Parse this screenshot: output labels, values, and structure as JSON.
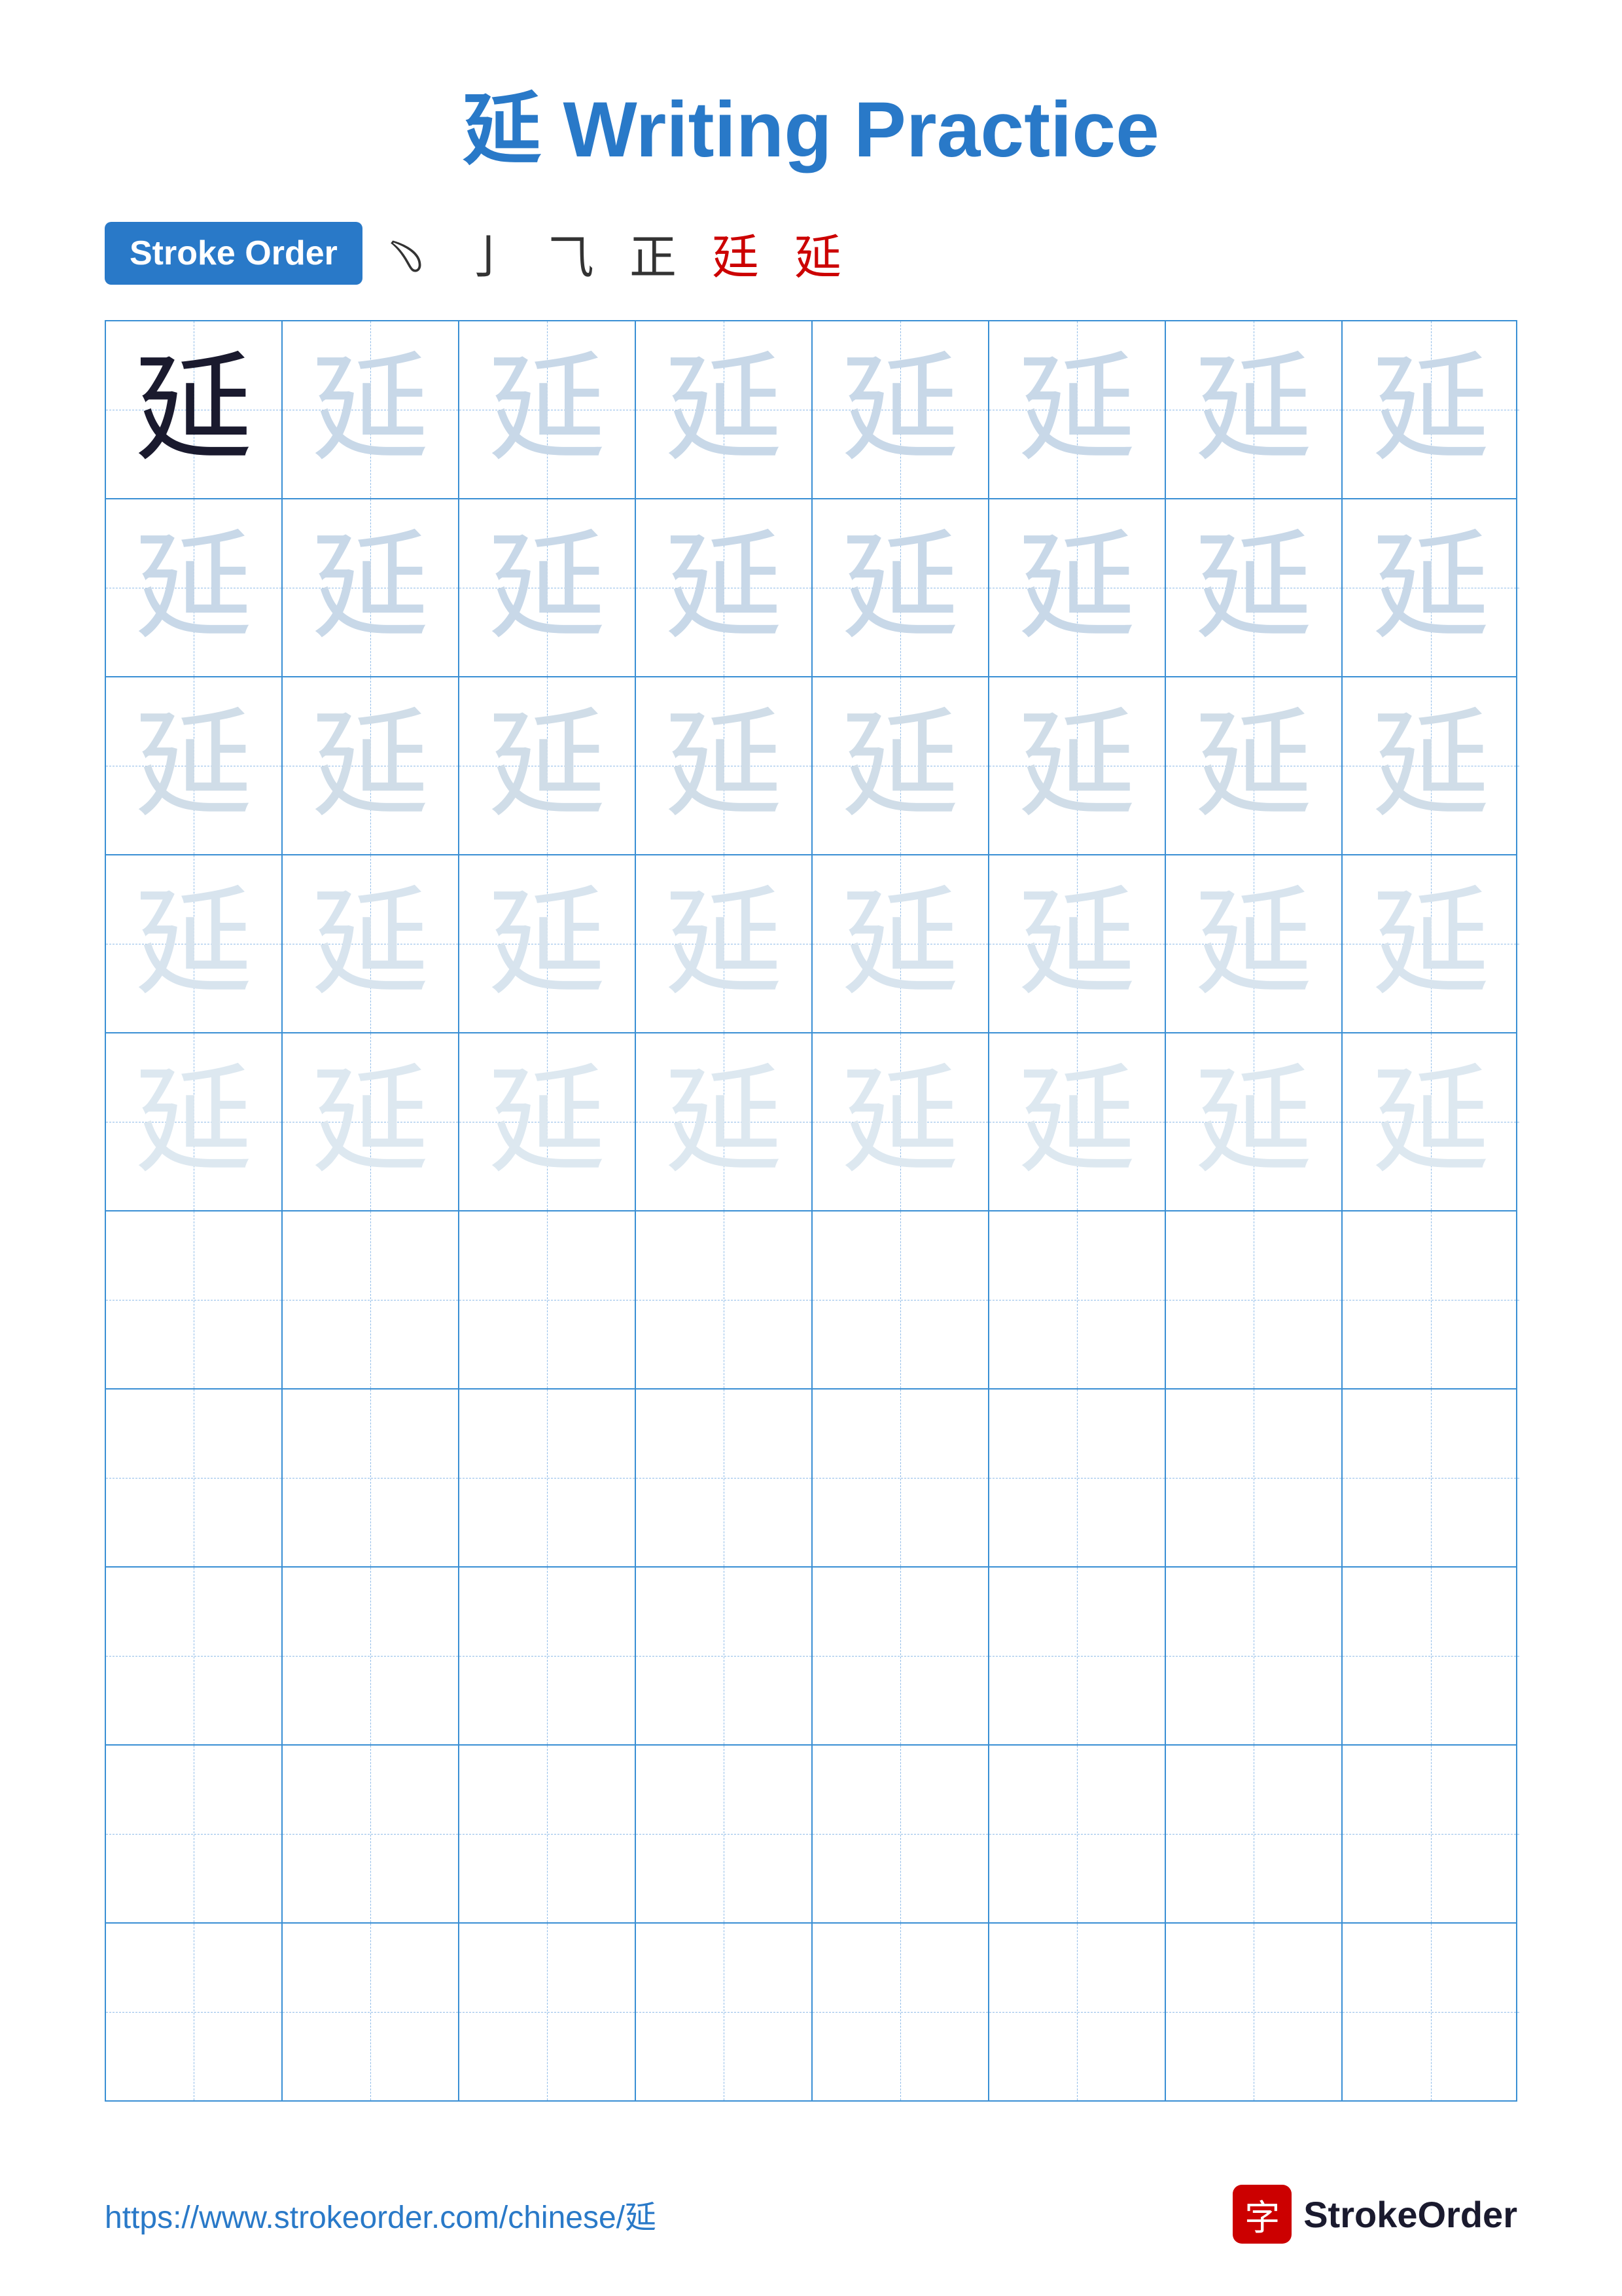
{
  "title": {
    "char": "延",
    "label": "Writing Practice"
  },
  "strokeOrder": {
    "badge": "Stroke Order",
    "strokes": [
      "﹆",
      "亅",
      "⺄",
      "正",
      "廷",
      "延"
    ]
  },
  "grid": {
    "rows": 10,
    "cols": 8,
    "character": "延",
    "filledRows": 5,
    "charStyles": [
      "char-dark",
      "char-light1",
      "char-light1",
      "char-light2",
      "char-light3",
      "char-light4",
      "char-light4",
      "char-light4"
    ]
  },
  "footer": {
    "url": "https://www.strokeorder.com/chinese/延",
    "brandIcon": "字",
    "brandName": "StrokeOrder"
  }
}
